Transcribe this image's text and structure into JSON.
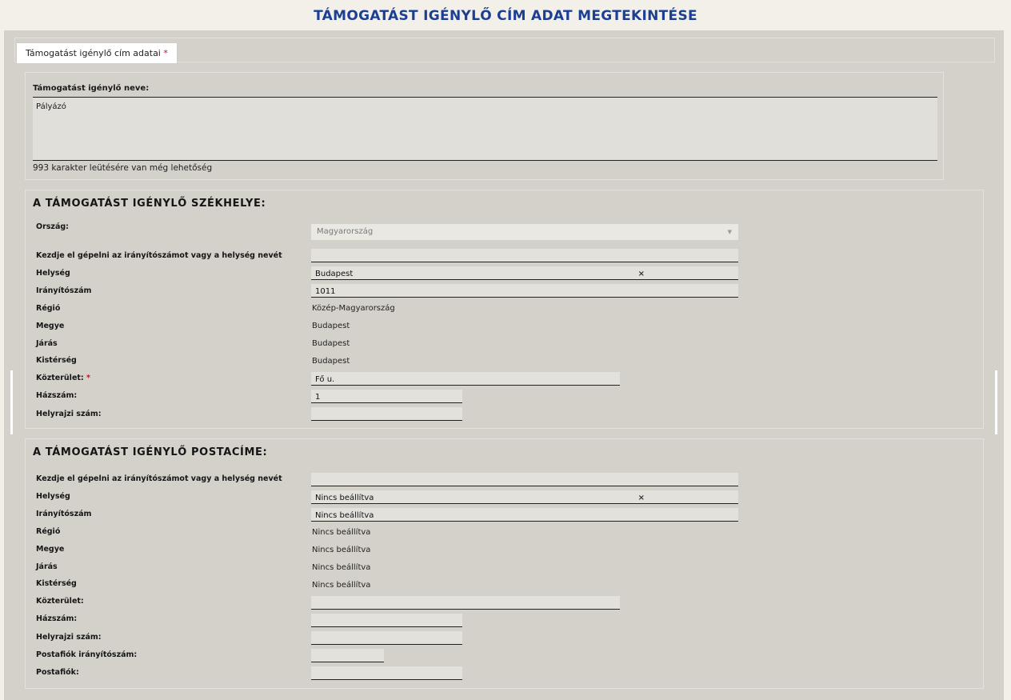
{
  "page": {
    "title": "TÁMOGATÁST IGÉNYLŐ CÍM ADAT MEGTEKINTÉSE"
  },
  "tab": {
    "label": "Támogatást igénylő cím adatai",
    "required_mark": "*"
  },
  "name_block": {
    "label": "Támogatást igénylő neve:",
    "value": "Pályázó",
    "char_count": "993 karakter leütésére van még lehetőség"
  },
  "seat": {
    "title": "A TÁMOGATÁST IGÉNYLŐ SZÉKHELYE:",
    "country_label": "Ország:",
    "country_value": "Magyarország",
    "search_label": "Kezdje el gépelni az irányítószámot vagy a helység nevét",
    "search_value": "",
    "city_label": "Helység",
    "city_value": "Budapest",
    "zip_label": "Irányítószám",
    "zip_value": "1011",
    "region_label": "Régió",
    "region_value": "Közép-Magyarország",
    "county_label": "Megye",
    "county_value": "Budapest",
    "district_label": "Járás",
    "district_value": "Budapest",
    "subregion_label": "Kistérség",
    "subregion_value": "Budapest",
    "street_label": "Közterület:",
    "street_required": "*",
    "street_value": "Fő u.",
    "house_label": "Házszám:",
    "house_value": "1",
    "lot_label": "Helyrajzi szám:",
    "lot_value": ""
  },
  "postal": {
    "title": "A TÁMOGATÁST IGÉNYLŐ POSTACÍME:",
    "search_label": "Kezdje el gépelni az irányítószámot vagy a helység nevét",
    "search_value": "",
    "city_label": "Helység",
    "city_value": "Nincs beállítva",
    "zip_label": "Irányítószám",
    "zip_value": "Nincs beállítva",
    "region_label": "Régió",
    "region_value": "Nincs beállítva",
    "county_label": "Megye",
    "county_value": "Nincs beállítva",
    "district_label": "Járás",
    "district_value": "Nincs beállítva",
    "subregion_label": "Kistérség",
    "subregion_value": "Nincs beállítva",
    "street_label": "Közterület:",
    "street_value": "",
    "house_label": "Házszám:",
    "house_value": "",
    "lot_label": "Helyrajzi szám:",
    "lot_value": "",
    "pobox_zip_label": "Postafiók irányítószám:",
    "pobox_zip_value": "",
    "pobox_label": "Postafiók:",
    "pobox_value": ""
  },
  "icons": {
    "clear": "×",
    "caret": "▼"
  },
  "colors": {
    "title": "#1c3f94",
    "required": "#c8102e",
    "background": "#d3d1ca"
  }
}
